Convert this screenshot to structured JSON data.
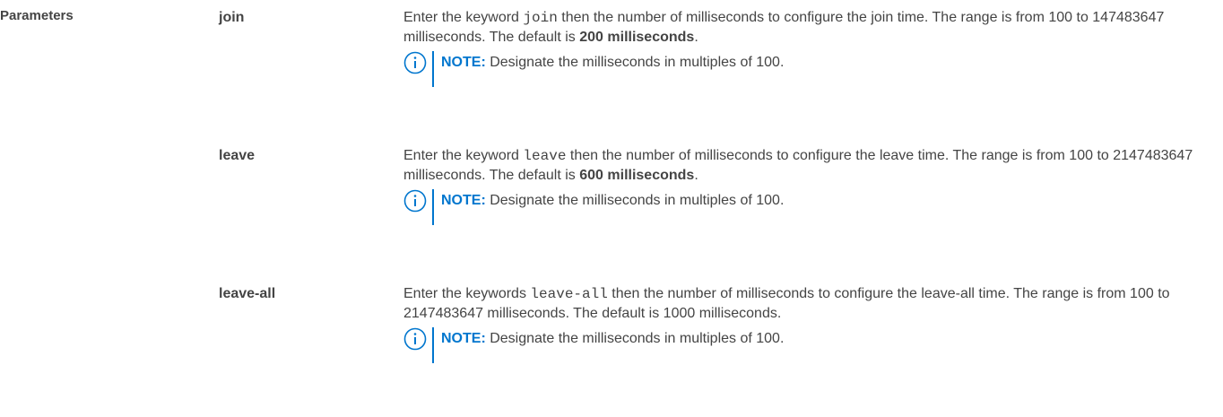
{
  "section": {
    "label": "Parameters"
  },
  "accent_color": "#0076CE",
  "note_icon": "info-circle-icon",
  "params": [
    {
      "name": "join",
      "desc_pre": "Enter the keyword ",
      "keyword": "join",
      "desc_post": " then the number of milliseconds to configure the join time. The range is from 100 to 147483647 milliseconds. The default is ",
      "default_bold": "200 milliseconds",
      "desc_end": ".",
      "note_label": "NOTE:",
      "note_text": " Designate the milliseconds in multiples of 100."
    },
    {
      "name": "leave",
      "desc_pre": "Enter the keyword ",
      "keyword": "leave",
      "desc_post": " then the number of milliseconds to configure the leave time. The range is from 100 to 2147483647 milliseconds. The default is ",
      "default_bold": "600 milliseconds",
      "desc_end": ".",
      "note_label": "NOTE:",
      "note_text": " Designate the milliseconds in multiples of 100."
    },
    {
      "name": "leave-all",
      "desc_pre": "Enter the keywords ",
      "keyword": "leave-all",
      "desc_post": " then the number of milliseconds to configure the leave-all time. The range is from 100 to 2147483647 milliseconds. The default is 1000 milliseconds.",
      "default_bold": "",
      "desc_end": "",
      "note_label": "NOTE:",
      "note_text": " Designate the milliseconds in multiples of 100."
    }
  ]
}
